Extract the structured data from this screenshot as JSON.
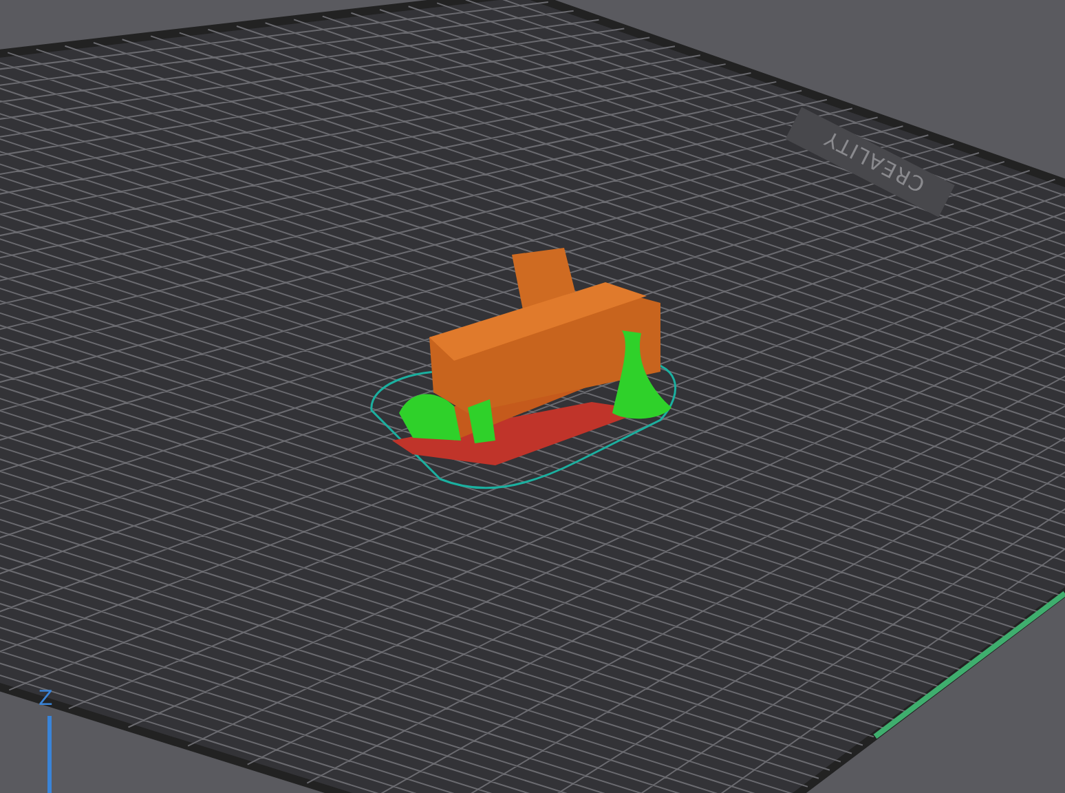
{
  "build_plate": {
    "logo": "CREALITY"
  },
  "axis": {
    "label": "Z"
  }
}
